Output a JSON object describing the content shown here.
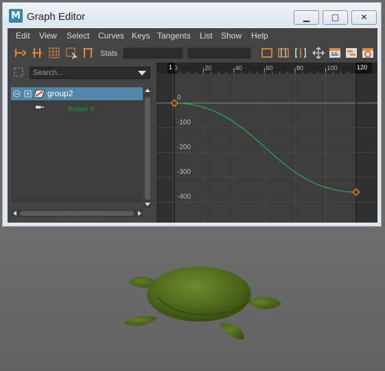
{
  "window": {
    "title": "Graph Editor",
    "app_icon": "M",
    "minimize_glyph": "▁",
    "maximize_glyph": "□",
    "close_glyph": "✕"
  },
  "menubar": [
    "Edit",
    "View",
    "Select",
    "Curves",
    "Keys",
    "Tangents",
    "List",
    "Show",
    "Help"
  ],
  "toolbar": {
    "stats_label": "Stats",
    "left_icons": [
      "move-key-icon",
      "insert-key-icon",
      "lattice-deform-icon",
      "region-select-icon",
      "retime-icon"
    ],
    "right_icons": [
      "frame-all-icon",
      "frame-playback-icon",
      "center-current-time-icon",
      "move-nearest-icon",
      "dope-sheet-icon",
      "trax-editor-icon",
      "time-editor-icon"
    ],
    "stat_field_1": "",
    "stat_field_2": ""
  },
  "outliner": {
    "search_placeholder": "Search...",
    "items": [
      {
        "label": "group2",
        "selected": true
      },
      {
        "label": "Rotate Y",
        "color": "#1e9d4a"
      }
    ]
  },
  "graph": {
    "time_ticks": [
      "0",
      "20",
      "40",
      "60",
      "80",
      "100"
    ],
    "value_ticks": [
      "0",
      "-100",
      "-200",
      "-300",
      "-400"
    ],
    "range_start": "1",
    "range_end": "120",
    "curve_color": "#2ea35a",
    "key_color": "#e0882a"
  },
  "chart_data": {
    "type": "line",
    "xlabel": "",
    "ylabel": "",
    "xlim": [
      -5,
      125
    ],
    "ylim": [
      -450,
      20
    ],
    "series": [
      {
        "name": "Rotate Y",
        "x": [
          1,
          120
        ],
        "y": [
          0,
          -360
        ]
      }
    ]
  }
}
